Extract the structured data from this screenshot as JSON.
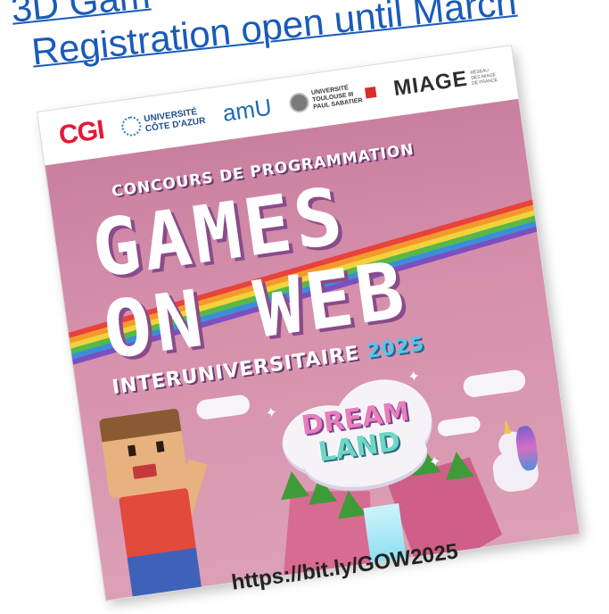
{
  "headline": {
    "line1": "3D Gam",
    "line2": "Registration open until March"
  },
  "poster": {
    "logos": {
      "cgi": "CGI",
      "uca_line1": "UNIVERSITÉ",
      "uca_line2": "CÔTE D'AZUR",
      "amu": "amU",
      "toulouse_line1": "UNIVERSITÉ",
      "toulouse_line2": "TOULOUSE III",
      "toulouse_line3": "PAUL SABATIER",
      "miage": "MIAGE",
      "miage_small_line1": "RÉSEAU",
      "miage_small_line2": "DES MIAGE",
      "miage_small_line3": "DE FRANCE"
    },
    "subtitle": "CONCOURS DE PROGRAMMATION",
    "title_line1": "GAMES",
    "title_line2": "ON WEB",
    "inter": "INTERUNIVERSITAIRE",
    "year": "2025",
    "theme_line1": "DREAM",
    "theme_line2": "LAND"
  },
  "url": "https://bit.ly/GOW2025",
  "colors": {
    "headline": "#1a5bb8",
    "cgi_red": "#e31937",
    "poster_pink": "#d690ac",
    "year_blue": "#57c4ea"
  },
  "rainbow": [
    "#e8423a",
    "#f39a2b",
    "#f3d33a",
    "#56b947",
    "#3a8fd8",
    "#7b4fbf"
  ]
}
